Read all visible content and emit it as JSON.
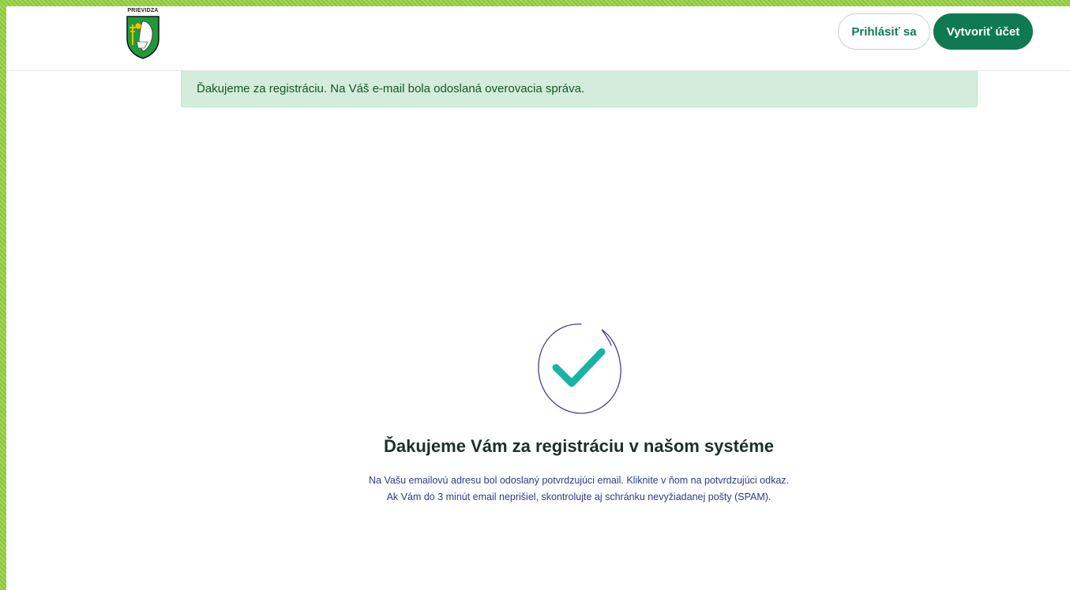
{
  "header": {
    "logo_text": "PRIEVIDZA",
    "login_label": "Prihlásiť sa",
    "register_label": "Vytvoriť účet"
  },
  "alert": {
    "message": "Ďakujeme za registráciu. Na Váš e-mail bola odoslaná overovacia správa."
  },
  "confirmation": {
    "icon": "checkmark-circle-icon",
    "title": "Ďakujeme Vám za registráciu v našom systéme",
    "line1": "Na Vašu emailovú adresu bol odoslaný potvrdzujúci email. Kliknite v ňom na potvrdzujúci odkaz.",
    "line2": "Ak Vám do 3 minút email neprišiel, skontrolujte aj schránku nevyžiadanej pošty (SPAM)."
  },
  "colors": {
    "brand_green": "#0f7a52",
    "alert_bg": "#d4ecdb",
    "alert_text": "#155724",
    "check_teal": "#19b2a6",
    "circle_stroke": "#4b3f9a",
    "description_text": "#2f3a8c"
  }
}
